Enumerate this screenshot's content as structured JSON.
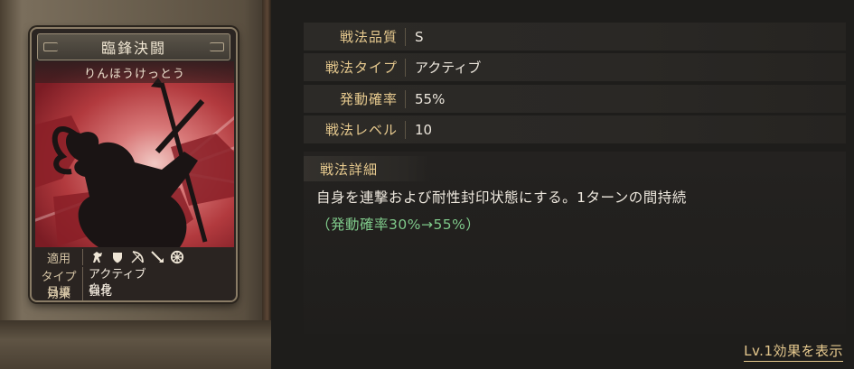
{
  "card": {
    "title": "臨鋒決闘",
    "reading": "りんほうけっとう",
    "info": {
      "units_label": "適用",
      "unit_icons": [
        "cavalry-icon",
        "shield-icon",
        "bow-icon",
        "spear-icon",
        "wheel-icon"
      ],
      "type_label": "タイプ",
      "type_value": "アクティブ",
      "effect_label": "効果",
      "effect_value": "強化",
      "target_label": "目標",
      "target_value": "自身"
    }
  },
  "stats": [
    {
      "label": "戦法品質",
      "value": "S"
    },
    {
      "label": "戦法タイプ",
      "value": "アクティブ"
    },
    {
      "label": "発動確率",
      "value": "55%"
    },
    {
      "label": "戦法レベル",
      "value": "10"
    }
  ],
  "detail": {
    "label": "戦法詳細",
    "text_main": "自身を連撃および耐性封印状態にする。1ターンの間持続",
    "text_green": "（発動確率30%→55%）"
  },
  "lv_link": "Lv.1効果を表示",
  "colors": {
    "accent_gold": "#e6c98e",
    "highlight_green": "#7fc98a",
    "art_red": "#b23a3e"
  }
}
